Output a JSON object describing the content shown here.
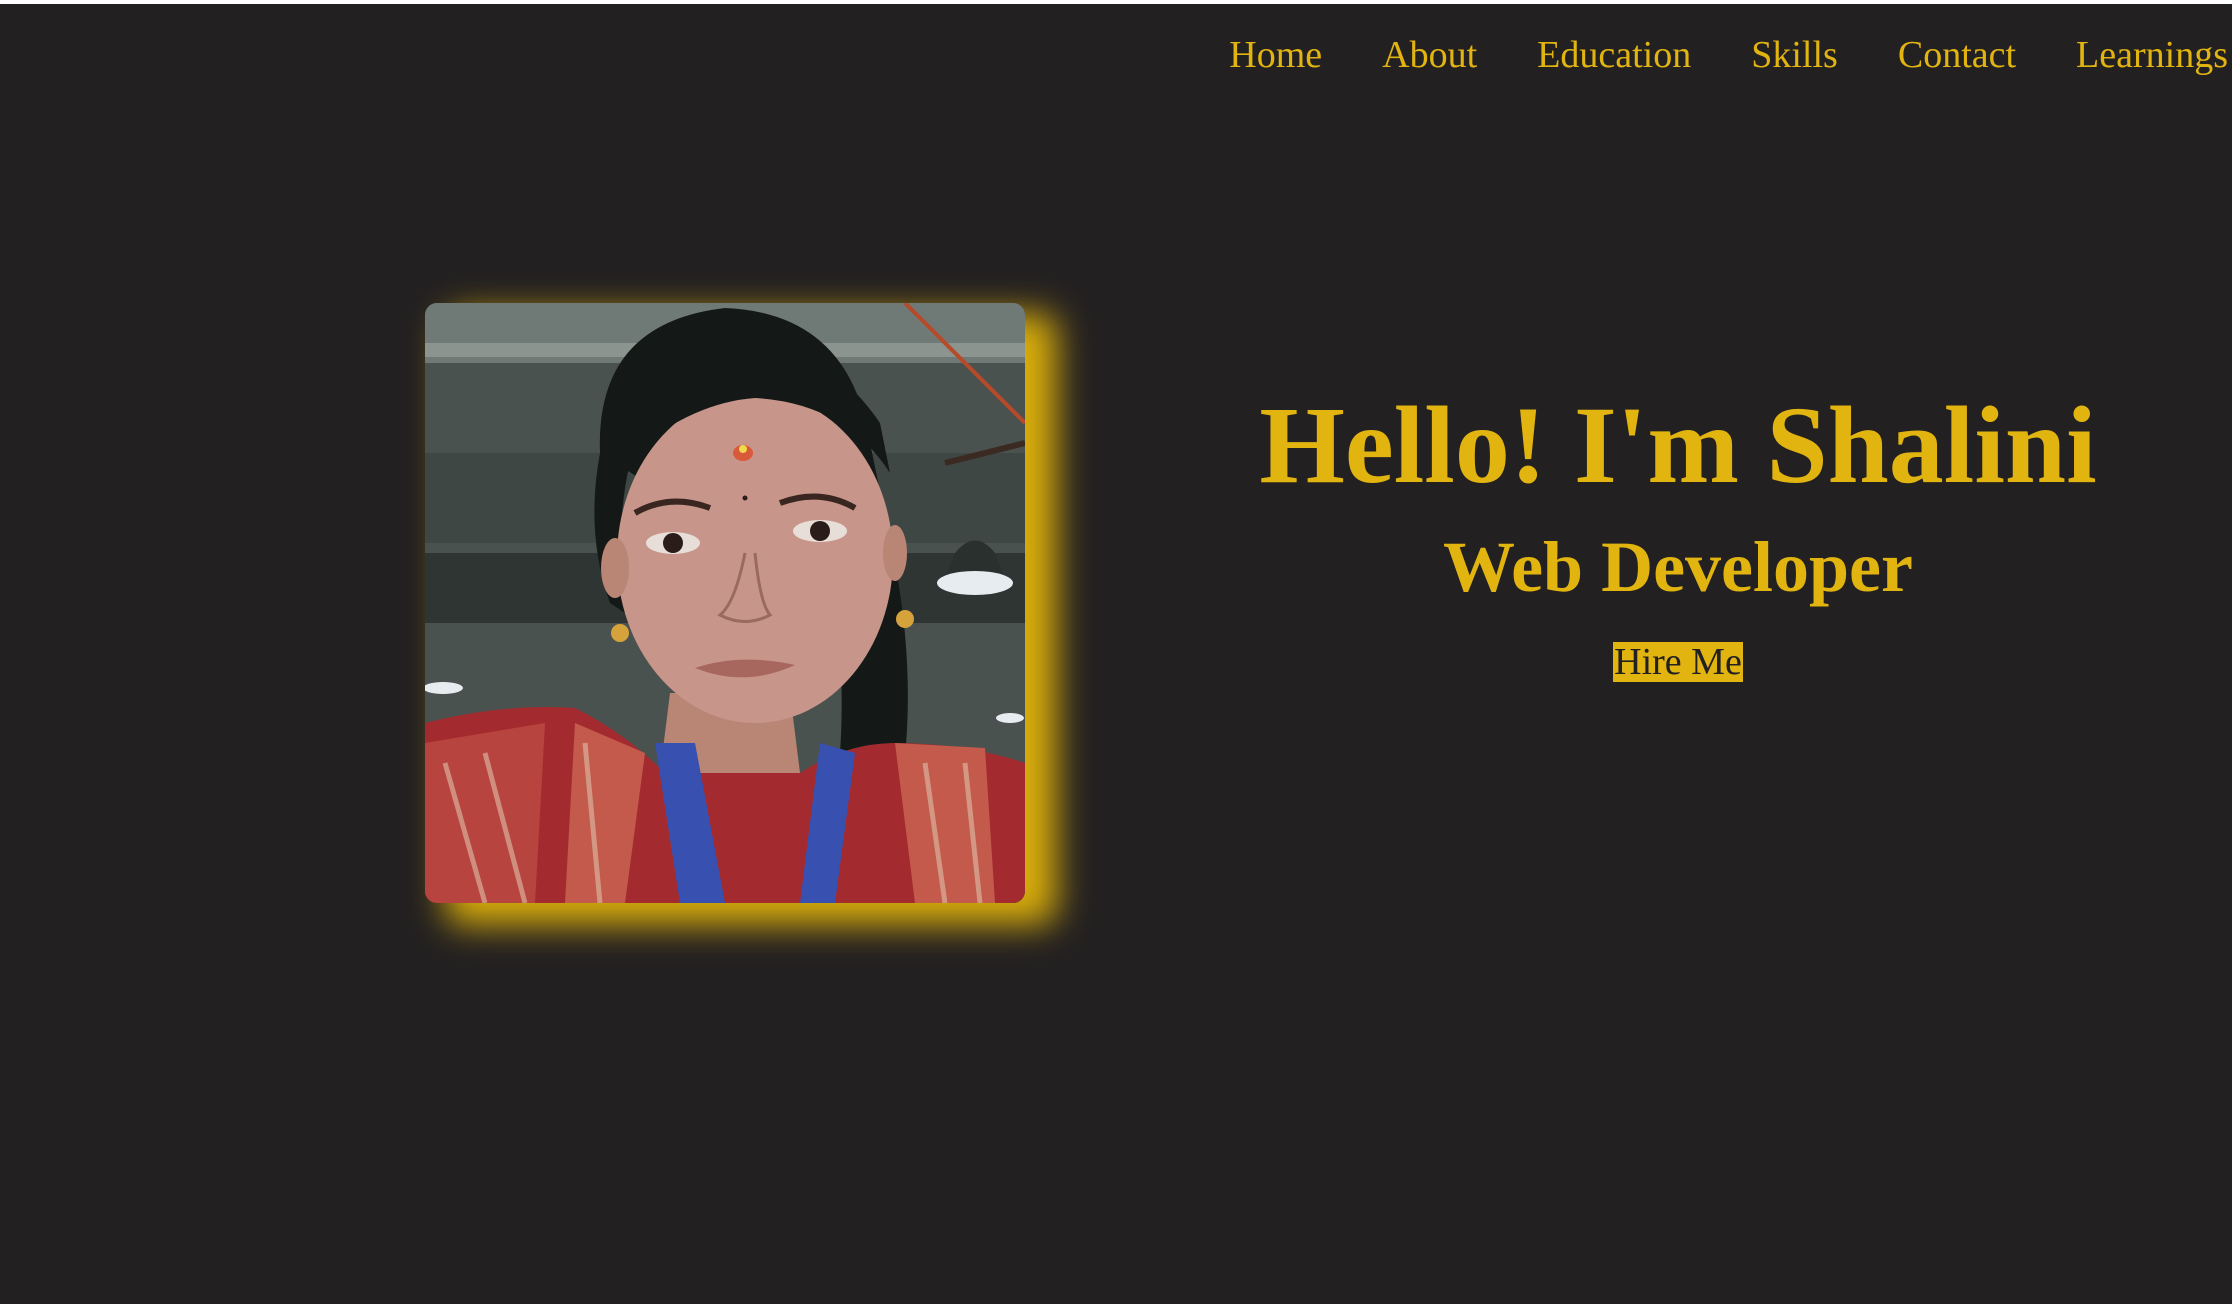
{
  "nav": {
    "items": [
      {
        "label": "Home"
      },
      {
        "label": "About"
      },
      {
        "label": "Education"
      },
      {
        "label": "Skills"
      },
      {
        "label": "Contact"
      },
      {
        "label": "Learnings"
      }
    ]
  },
  "hero": {
    "title": "Hello! I'm Shalini",
    "subtitle": "Web Developer",
    "cta_label": "Hire Me",
    "profile_photo": "profile photo"
  },
  "colors": {
    "background": "#232021",
    "accent": "#e1b410",
    "glow": "#d9ad0c",
    "button_text": "#232021"
  }
}
